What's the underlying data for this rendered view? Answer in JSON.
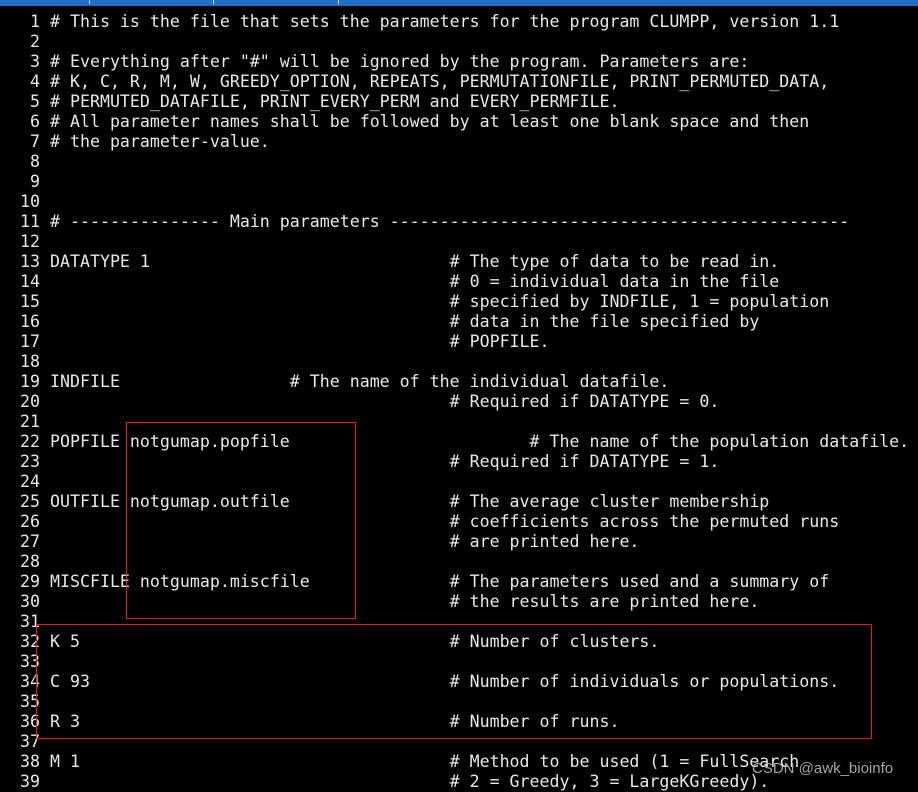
{
  "colors": {
    "text": "#e8e8e8",
    "background": "#000000",
    "highlight_box": "#e0201c",
    "tab_bar": "#1e6fc8"
  },
  "lines": [
    "# This is the file that sets the parameters for the program CLUMPP, version 1.1",
    "",
    "# Everything after \"#\" will be ignored by the program. Parameters are:",
    "# K, C, R, M, W, GREEDY_OPTION, REPEATS, PERMUTATIONFILE, PRINT_PERMUTED_DATA,",
    "# PERMUTED_DATAFILE, PRINT_EVERY_PERM and EVERY_PERMFILE.",
    "# All parameter names shall be followed by at least one blank space and then",
    "# the parameter-value.",
    "",
    "",
    "",
    "# --------------- Main parameters ----------------------------------------------",
    "",
    "DATATYPE 1                              # The type of data to be read in.",
    "                                        # 0 = individual data in the file",
    "                                        # specified by INDFILE, 1 = population",
    "                                        # data in the file specified by",
    "                                        # POPFILE.",
    "",
    "INDFILE                 # The name of the individual datafile.",
    "                                        # Required if DATATYPE = 0.",
    "",
    "POPFILE notgumap.popfile                        # The name of the population datafile.",
    "                                        # Required if DATATYPE = 1.",
    "",
    "OUTFILE notgumap.outfile                # The average cluster membership",
    "                                        # coefficients across the permuted runs",
    "                                        # are printed here.",
    "",
    "MISCFILE notgumap.miscfile              # The parameters used and a summary of",
    "                                        # the results are printed here.",
    "",
    "K 5                                     # Number of clusters.",
    "",
    "C 93                                    # Number of individuals or populations.",
    "",
    "R 3                                     # Number of runs.",
    "",
    "M 1                                     # Method to be used (1 = FullSearch",
    "                                        # 2 = Greedy, 3 = LargeKGreedy)."
  ],
  "watermark": "CSDN @awk_bioinfo"
}
